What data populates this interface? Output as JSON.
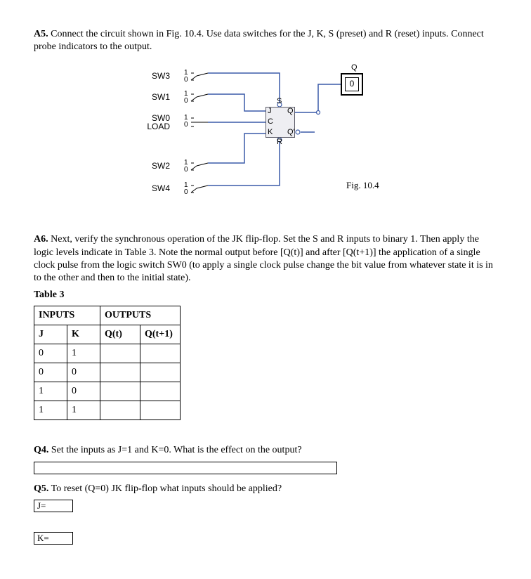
{
  "a5": {
    "label": "A5.",
    "text": "Connect the circuit shown in Fig. 10.4. Use data switches for the J, K, S (preset) and R (reset) inputs. Connect probe indicators to the output."
  },
  "diagram": {
    "sw3": "SW3",
    "sw1": "SW1",
    "sw0line1": "SW0",
    "sw0line2": "LOAD",
    "sw2": "SW2",
    "sw4": "SW4",
    "tick1": "1",
    "tick0": "0",
    "pinJ": "J",
    "pinC": "C",
    "pinK": "K",
    "pinS": "S",
    "pinR": "R",
    "pinQ": "Q",
    "pinQbar": "Q'",
    "probeQ": "Q",
    "probeVal": "0",
    "figlabel": "Fig. 10.4"
  },
  "a6": {
    "label": "A6.",
    "text": "Next, verify the synchronous operation of the JK flip-flop. Set the S and R inputs to binary 1. Then apply the logic levels indicate in Table 3. Note the normal output before [Q(t)] and after [Q(t+1)] the application of a single clock pulse from the logic switch SW0 (to apply  a single clock pulse change the bit value from whatever state it is in to the other and then to  the initial state)."
  },
  "table3": {
    "title": "Table 3",
    "hdr_inputs": "INPUTS",
    "hdr_outputs": "OUTPUTS",
    "hdr_J": "J",
    "hdr_K": "K",
    "hdr_Qt": "Q(t)",
    "hdr_Qt1": "Q(t+1)",
    "rows": [
      {
        "J": "0",
        "K": "1",
        "Qt": "",
        "Qt1": ""
      },
      {
        "J": "0",
        "K": "0",
        "Qt": "",
        "Qt1": ""
      },
      {
        "J": "1",
        "K": "0",
        "Qt": "",
        "Qt1": ""
      },
      {
        "J": "1",
        "K": "1",
        "Qt": "",
        "Qt1": ""
      }
    ]
  },
  "q4": {
    "label": "Q4.",
    "text": "Set the inputs as J=1 and K=0. What is the effect on the output?"
  },
  "q5": {
    "label": "Q5.",
    "text": "To  reset  (Q=0)  JK  flip-flop  what  inputs  should  be  applied?",
    "Jlabel": "J=",
    "Klabel": "K="
  }
}
